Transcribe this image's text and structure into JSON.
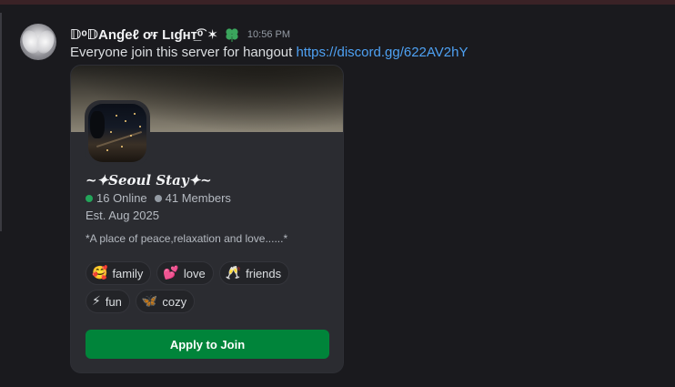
{
  "message": {
    "author": "𝔻ᵒ𝔻Anɠeℓ ơғ Lιɠнт̲͡ᵒ ✶",
    "author_badge_icon": "clover-icon",
    "timestamp": "10:56 PM",
    "text": "Everyone join this server for hangout ",
    "link": "https://discord.gg/622AV2hY"
  },
  "invite": {
    "server_name": "~✦𝑺𝒆𝒐𝒖𝒍 𝑺𝒕𝒂𝒚✦~",
    "online": "16 Online",
    "members": "41 Members",
    "established": "Est. Aug 2025",
    "description": "*A place of peace,relaxation and love......*",
    "tags": [
      [
        {
          "emoji": "🥰",
          "label": "family"
        },
        {
          "emoji": "💕",
          "label": "love"
        },
        {
          "emoji": "🥂",
          "label": "friends"
        }
      ],
      [
        {
          "emoji": "⚡",
          "label": "fun"
        },
        {
          "emoji": "🦋",
          "label": "cozy"
        }
      ]
    ],
    "join_label": "Apply to Join"
  },
  "colors": {
    "online": "#23a55a",
    "members": "#949ba4",
    "join_button": "#00843a",
    "link": "#4ea1f3"
  }
}
